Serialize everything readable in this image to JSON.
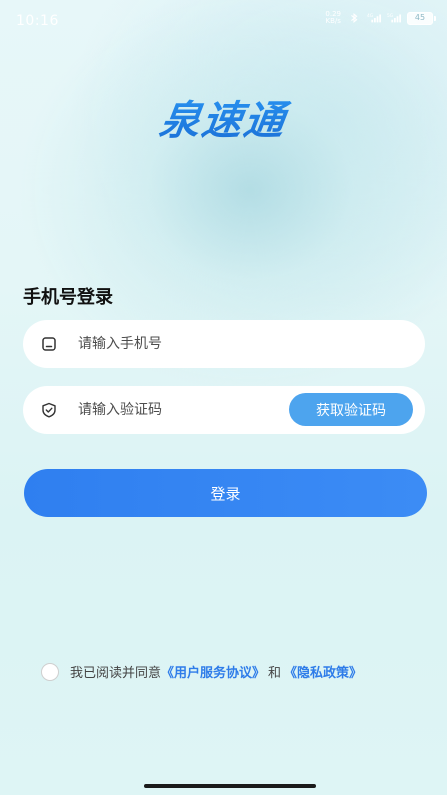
{
  "status_bar": {
    "time": "10:16",
    "net_speed_value": "0.29",
    "net_speed_unit": "KB/s",
    "signal_1": "4G",
    "signal_2": "5G",
    "battery": "45"
  },
  "logo": {
    "text": "泉速通"
  },
  "login": {
    "title": "手机号登录",
    "phone_placeholder": "请输入手机号",
    "code_placeholder": "请输入验证码",
    "get_code_label": "获取验证码",
    "submit_label": "登录"
  },
  "agreement": {
    "prefix": "我已阅读并同意",
    "user_agreement": "《用户服务协议》",
    "and": "和",
    "privacy_policy": "《隐私政策》"
  },
  "colors": {
    "primary": "#2f7ff0",
    "get_code_bg": "#4da4ee",
    "link": "#2e7ce9"
  }
}
